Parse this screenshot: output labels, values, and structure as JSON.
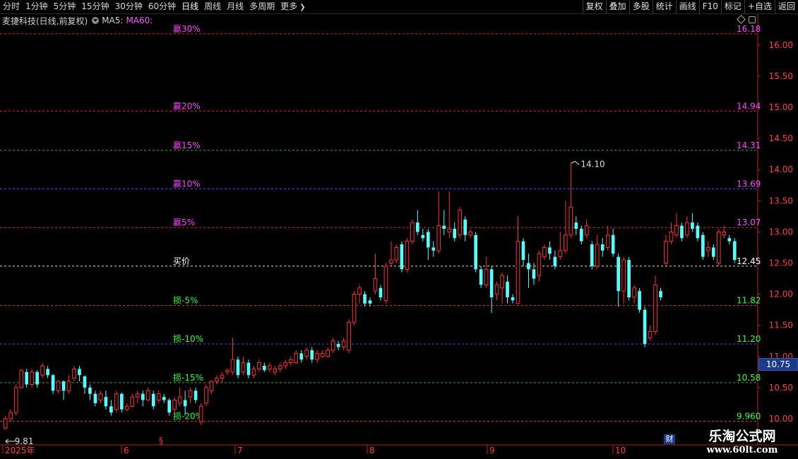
{
  "toolbar": {
    "periods": [
      "分时",
      "1分钟",
      "5分钟",
      "15分钟",
      "30分钟",
      "60分钟",
      "日线",
      "周线",
      "月线",
      "多周期"
    ],
    "active_period": "日线",
    "more_label": "更多",
    "right_buttons": [
      "复权",
      "叠加",
      "多股",
      "统计",
      "画线",
      "F10",
      "标记",
      "+自选",
      "返回"
    ]
  },
  "title": {
    "stock_name": "麦捷科技(日线,前复权)",
    "ma5_label": "MA5:",
    "ma60_label": "MA60:"
  },
  "levels": [
    {
      "label": "赢30%",
      "value": 16.18,
      "label_color": "#ff44ff",
      "line_color": "#ff3333",
      "value_color": "#ff44ff"
    },
    {
      "label": "赢20%",
      "value": 14.94,
      "label_color": "#ff44ff",
      "line_color": "#ff3333",
      "value_color": "#ff44ff"
    },
    {
      "label": "赢15%",
      "value": 14.31,
      "label_color": "#ff44ff",
      "line_color": "#33cc33",
      "value_color": "#ff44ff"
    },
    {
      "label": "赢10%",
      "value": 13.69,
      "label_color": "#ff44ff",
      "line_color": "#5555ff",
      "value_color": "#ff44ff"
    },
    {
      "label": "赢5%",
      "value": 13.07,
      "label_color": "#ff44ff",
      "line_color": "#ff3333",
      "value_color": "#ff44ff"
    },
    {
      "label": "买价",
      "value": 12.45,
      "label_color": "#ffffff",
      "line_color": "#ffffff",
      "value_color": "#ffffff"
    },
    {
      "label": "损-5%",
      "value": 11.82,
      "label_color": "#33ff33",
      "line_color": "#ff3333",
      "value_color": "#33ff33"
    },
    {
      "label": "损-10%",
      "value": 11.2,
      "label_color": "#33ff33",
      "line_color": "#5555ff",
      "value_color": "#33ff33"
    },
    {
      "label": "损-15%",
      "value": 10.58,
      "label_color": "#33ff33",
      "line_color": "#33cc33",
      "value_color": "#33ff33"
    },
    {
      "label": "损-20%",
      "value": 9.96,
      "label_color": "#33ff33",
      "line_color": "#ff3333",
      "value_color": "#33ff33"
    }
  ],
  "level_values_text": [
    "16.18",
    "14.94",
    "14.31",
    "13.69",
    "13.07",
    "12.45",
    "11.82",
    "11.20",
    "10.58",
    "9.960"
  ],
  "price_axis_ticks": [
    "16.00",
    "15.50",
    "15.00",
    "14.50",
    "14.00",
    "13.50",
    "13.00",
    "12.50",
    "12.00",
    "11.50",
    "11.00",
    "10.50",
    "10.00"
  ],
  "current_price": "10.75",
  "high_marker": "14.10",
  "low_marker": "9.81",
  "date_axis": [
    "2025年",
    "6",
    "7",
    "8",
    "9",
    "10"
  ],
  "finance_badge": "财",
  "event_marker": "§",
  "logo": {
    "line1": "乐淘公式网",
    "line2": "www.60lt.com"
  },
  "colors": {
    "up": "#ff3232",
    "down": "#54ffff",
    "grid": "#8b0000",
    "axis": "#c02020"
  },
  "chart_data": {
    "type": "candlestick",
    "y_range": [
      9.85,
      16.2
    ],
    "candles": [
      [
        9.85,
        10.0,
        9.82,
        10.05
      ],
      [
        10.0,
        10.1,
        9.95,
        10.15
      ],
      [
        10.1,
        10.5,
        10.05,
        10.55
      ],
      [
        10.5,
        10.78,
        10.48,
        10.8
      ],
      [
        10.75,
        10.55,
        10.5,
        10.8
      ],
      [
        10.55,
        10.75,
        10.5,
        10.8
      ],
      [
        10.75,
        10.55,
        10.5,
        10.78
      ],
      [
        10.7,
        10.85,
        10.65,
        10.9
      ],
      [
        10.8,
        10.7,
        10.65,
        10.85
      ],
      [
        10.7,
        10.45,
        10.4,
        10.72
      ],
      [
        10.45,
        10.6,
        10.4,
        10.62
      ],
      [
        10.6,
        10.45,
        10.3,
        10.62
      ],
      [
        10.45,
        10.6,
        10.4,
        10.7
      ],
      [
        10.65,
        10.8,
        10.6,
        10.85
      ],
      [
        10.8,
        10.7,
        10.6,
        10.85
      ],
      [
        10.68,
        10.5,
        10.4,
        10.7
      ],
      [
        10.5,
        10.4,
        10.3,
        10.55
      ],
      [
        10.4,
        10.25,
        10.2,
        10.45
      ],
      [
        10.3,
        10.4,
        10.25,
        10.45
      ],
      [
        10.35,
        10.2,
        10.15,
        10.45
      ],
      [
        10.2,
        10.1,
        10.05,
        10.3
      ],
      [
        10.15,
        10.4,
        10.1,
        10.45
      ],
      [
        10.4,
        10.15,
        10.1,
        10.42
      ],
      [
        10.15,
        10.2,
        10.12,
        10.25
      ],
      [
        10.2,
        10.35,
        10.18,
        10.4
      ],
      [
        10.35,
        10.4,
        10.25,
        10.45
      ],
      [
        10.4,
        10.3,
        10.2,
        10.45
      ],
      [
        10.3,
        10.45,
        10.28,
        10.5
      ],
      [
        10.4,
        10.2,
        10.15,
        10.45
      ],
      [
        10.3,
        10.4,
        10.25,
        10.45
      ],
      [
        10.35,
        10.3,
        10.25,
        10.4
      ],
      [
        10.3,
        10.1,
        10.05,
        10.33
      ],
      [
        10.15,
        10.3,
        10.1,
        10.35
      ],
      [
        10.25,
        10.35,
        10.2,
        10.5
      ],
      [
        10.3,
        10.2,
        10.05,
        10.45
      ],
      [
        10.35,
        10.45,
        10.25,
        10.5
      ],
      [
        10.45,
        10.3,
        10.25,
        10.5
      ],
      [
        9.95,
        10.2,
        9.9,
        10.25
      ],
      [
        10.25,
        10.5,
        10.2,
        10.55
      ],
      [
        10.45,
        10.6,
        10.4,
        10.62
      ],
      [
        10.6,
        10.65,
        10.55,
        10.7
      ],
      [
        10.65,
        10.7,
        10.58,
        10.75
      ],
      [
        10.75,
        10.78,
        10.7,
        10.8
      ],
      [
        10.75,
        10.95,
        10.7,
        11.3
      ],
      [
        10.95,
        10.7,
        10.65,
        11.0
      ],
      [
        10.75,
        10.9,
        10.7,
        11.0
      ],
      [
        10.9,
        10.7,
        10.65,
        10.95
      ],
      [
        10.7,
        10.8,
        10.65,
        10.85
      ],
      [
        10.8,
        10.9,
        10.75,
        10.95
      ],
      [
        10.85,
        10.78,
        10.75,
        10.9
      ],
      [
        10.8,
        10.85,
        10.75,
        10.9
      ],
      [
        10.75,
        10.8,
        10.7,
        10.85
      ],
      [
        10.8,
        10.85,
        10.75,
        10.9
      ],
      [
        10.85,
        10.9,
        10.8,
        10.95
      ],
      [
        10.9,
        10.95,
        10.85,
        11.0
      ],
      [
        10.9,
        11.05,
        10.88,
        11.1
      ],
      [
        11.05,
        10.95,
        10.9,
        11.1
      ],
      [
        11.0,
        11.1,
        10.95,
        11.15
      ],
      [
        11.1,
        10.95,
        10.9,
        11.15
      ],
      [
        10.95,
        11.05,
        10.9,
        11.1
      ],
      [
        11.0,
        11.05,
        10.98,
        11.1
      ],
      [
        11.0,
        11.1,
        10.98,
        11.15
      ],
      [
        11.1,
        11.25,
        11.05,
        11.3
      ],
      [
        11.2,
        11.15,
        11.1,
        11.25
      ],
      [
        11.15,
        11.25,
        11.1,
        11.3
      ],
      [
        11.1,
        11.55,
        11.05,
        11.6
      ],
      [
        11.55,
        12.0,
        11.5,
        12.05
      ],
      [
        12.0,
        12.1,
        11.85,
        12.15
      ],
      [
        12.0,
        11.85,
        11.8,
        12.05
      ],
      [
        11.9,
        11.85,
        11.8,
        11.95
      ],
      [
        12.05,
        12.25,
        12.0,
        12.65
      ],
      [
        12.1,
        11.95,
        11.9,
        12.15
      ],
      [
        11.9,
        12.45,
        11.85,
        12.5
      ],
      [
        12.5,
        12.55,
        12.45,
        12.85
      ],
      [
        12.55,
        12.75,
        12.5,
        12.8
      ],
      [
        12.8,
        12.4,
        12.35,
        12.85
      ],
      [
        12.4,
        12.85,
        12.35,
        12.9
      ],
      [
        12.85,
        13.15,
        12.8,
        13.2
      ],
      [
        13.15,
        13.0,
        12.95,
        13.35
      ],
      [
        12.95,
        12.9,
        12.85,
        13.05
      ],
      [
        13.0,
        12.75,
        12.55,
        13.05
      ],
      [
        12.75,
        12.7,
        12.6,
        12.85
      ],
      [
        12.7,
        13.1,
        12.65,
        13.65
      ],
      [
        13.1,
        13.05,
        12.95,
        13.35
      ],
      [
        13.0,
        13.05,
        12.9,
        13.65
      ],
      [
        13.05,
        12.9,
        12.85,
        13.15
      ],
      [
        12.95,
        13.35,
        12.9,
        13.4
      ],
      [
        13.2,
        12.95,
        12.85,
        13.25
      ],
      [
        12.95,
        13.0,
        12.9,
        13.05
      ],
      [
        12.95,
        12.4,
        12.35,
        13.0
      ],
      [
        12.4,
        12.15,
        12.1,
        12.45
      ],
      [
        12.15,
        12.4,
        12.1,
        12.6
      ],
      [
        12.4,
        11.95,
        11.7,
        12.45
      ],
      [
        12.0,
        12.15,
        11.9,
        12.2
      ],
      [
        12.1,
        12.3,
        11.85,
        12.35
      ],
      [
        12.2,
        11.95,
        11.85,
        12.3
      ],
      [
        11.95,
        11.9,
        11.85,
        12.0
      ],
      [
        11.85,
        12.85,
        11.85,
        13.25
      ],
      [
        12.85,
        12.55,
        12.45,
        12.9
      ],
      [
        12.5,
        12.4,
        12.1,
        12.65
      ],
      [
        12.4,
        12.25,
        12.15,
        12.5
      ],
      [
        12.3,
        12.65,
        12.2,
        12.7
      ],
      [
        12.6,
        12.75,
        12.55,
        12.8
      ],
      [
        12.75,
        12.65,
        12.55,
        12.85
      ],
      [
        12.6,
        12.45,
        12.4,
        12.7
      ],
      [
        12.6,
        12.7,
        12.55,
        13.0
      ],
      [
        12.7,
        12.95,
        12.65,
        13.5
      ],
      [
        12.95,
        13.4,
        12.9,
        14.1
      ],
      [
        13.15,
        13.05,
        12.95,
        13.25
      ],
      [
        13.05,
        12.85,
        12.8,
        13.1
      ],
      [
        12.95,
        13.1,
        12.9,
        13.2
      ],
      [
        12.8,
        12.45,
        12.4,
        12.85
      ],
      [
        12.45,
        12.8,
        12.4,
        12.95
      ],
      [
        12.8,
        12.7,
        12.6,
        12.9
      ],
      [
        12.75,
        12.95,
        12.7,
        13.1
      ],
      [
        12.95,
        12.65,
        12.6,
        13.05
      ],
      [
        12.6,
        12.05,
        11.8,
        12.65
      ],
      [
        12.05,
        12.55,
        11.85,
        12.6
      ],
      [
        12.55,
        11.95,
        11.9,
        12.6
      ],
      [
        11.95,
        12.1,
        11.85,
        12.15
      ],
      [
        12.05,
        11.75,
        11.7,
        12.1
      ],
      [
        11.75,
        11.2,
        11.15,
        11.8
      ],
      [
        11.3,
        11.4,
        11.25,
        11.5
      ],
      [
        11.4,
        12.15,
        11.35,
        12.3
      ],
      [
        12.05,
        11.95,
        11.9,
        12.1
      ],
      [
        12.5,
        12.85,
        12.45,
        12.95
      ],
      [
        12.85,
        13.0,
        12.8,
        13.15
      ],
      [
        12.95,
        13.1,
        12.9,
        13.3
      ],
      [
        13.1,
        12.9,
        12.85,
        13.15
      ],
      [
        12.95,
        13.15,
        12.9,
        13.25
      ],
      [
        13.15,
        13.05,
        13.0,
        13.3
      ],
      [
        13.1,
        12.9,
        12.85,
        13.15
      ],
      [
        12.95,
        12.6,
        12.55,
        13.0
      ],
      [
        12.7,
        12.75,
        12.6,
        12.85
      ],
      [
        12.75,
        12.6,
        12.55,
        12.8
      ],
      [
        12.5,
        13.0,
        12.45,
        13.05
      ],
      [
        12.95,
        13.0,
        12.9,
        13.1
      ],
      [
        12.9,
        12.85,
        12.8,
        12.95
      ],
      [
        12.85,
        12.55,
        12.5,
        12.9
      ]
    ]
  }
}
